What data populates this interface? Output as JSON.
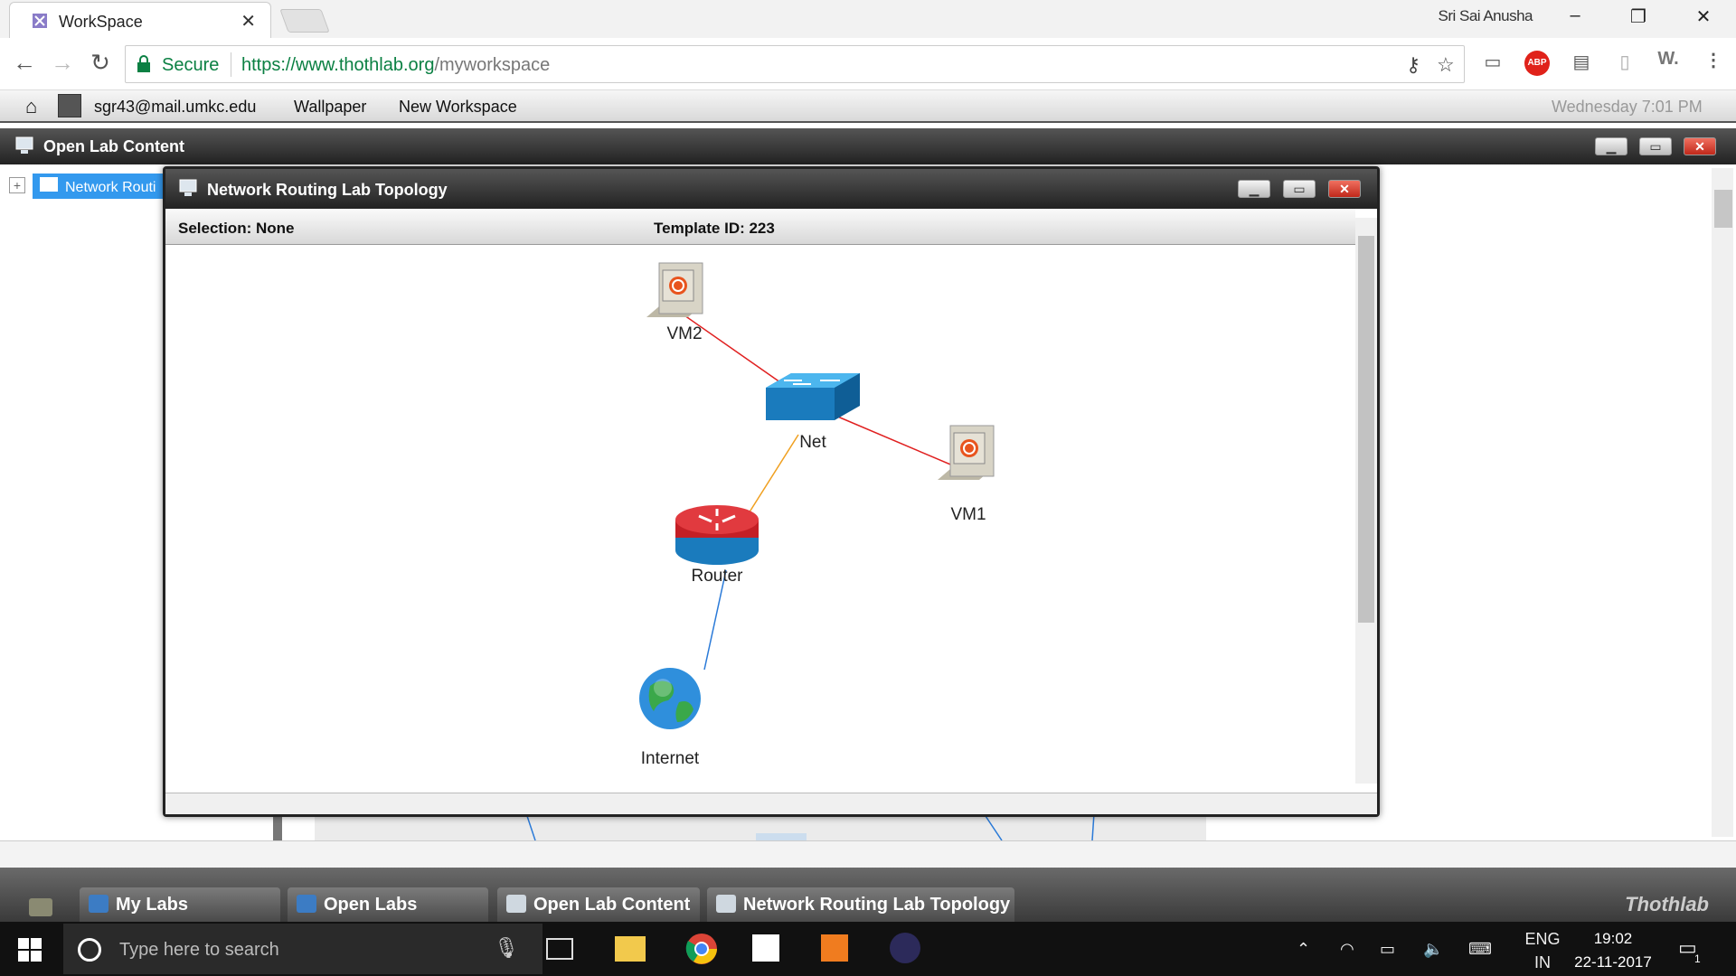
{
  "browser": {
    "tab_title": "WorkSpace",
    "user_name": "Sri Sai Anusha",
    "secure_label": "Secure",
    "url_base": "https://www.thothlab.org",
    "url_path": "/myworkspace"
  },
  "sitebar": {
    "email": "sgr43@mail.umkc.edu",
    "wallpaper": "Wallpaper",
    "new_workspace": "New Workspace",
    "datetime": "Wednesday 7:01 PM"
  },
  "outer_window": {
    "title": "Open Lab Content",
    "tree_item": "Network Routi"
  },
  "topology_window": {
    "title": "Network Routing Lab Topology",
    "selection": "Selection: None",
    "template_id": "Template ID: 223",
    "nodes": {
      "vm2": "VM2",
      "net": "Net",
      "vm1": "VM1",
      "router": "Router",
      "internet": "Internet"
    },
    "link_colors": {
      "vm_links": "#e02020",
      "router_net": "#f0a020",
      "internet_router": "#2a7ad8"
    }
  },
  "app_taskbar": {
    "items": [
      "My Labs",
      "Open Labs",
      "Open Lab Content",
      "Network Routing Lab Topology"
    ],
    "brand": "Thothlab"
  },
  "win_taskbar": {
    "search_placeholder": "Type here to search",
    "lang": "ENG",
    "region": "IN",
    "time": "19:02",
    "date": "22-11-2017",
    "notifications": "1"
  }
}
